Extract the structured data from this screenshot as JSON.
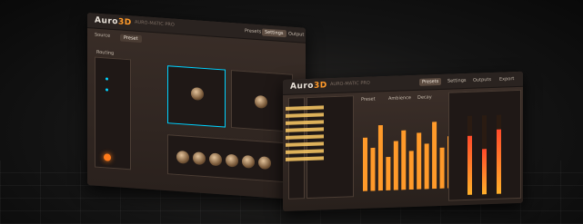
{
  "window1": {
    "logo_text": "Auro",
    "logo_badge": "3D",
    "subtitle": "AURO-MATIC PRO",
    "tabs": [
      {
        "label": "Presets"
      },
      {
        "label": "Settings"
      },
      {
        "label": "Output"
      }
    ],
    "left_label": "Source",
    "preset_button": "Preset",
    "routing_label": "Routing"
  },
  "window2": {
    "logo_text": "Auro",
    "logo_badge": "3D",
    "subtitle": "AURO-MATIC PRO",
    "tabs": [
      {
        "label": "Presets"
      },
      {
        "label": "Settings"
      },
      {
        "label": "Outputs"
      },
      {
        "label": "Export"
      }
    ],
    "controls": [
      {
        "label": "Preset"
      },
      {
        "label": "Ambience"
      },
      {
        "label": "Decay"
      }
    ]
  },
  "chart_data": {
    "type": "bar",
    "values": [
      72,
      58,
      88,
      45,
      66,
      80,
      52,
      76,
      61,
      90,
      55,
      70
    ],
    "ylim": [
      0,
      100
    ]
  },
  "meters": {
    "levels": [
      0.75,
      0.58,
      0.82
    ]
  },
  "colors": {
    "accent": "#ff9a2a",
    "cyan": "#00d2ff"
  }
}
